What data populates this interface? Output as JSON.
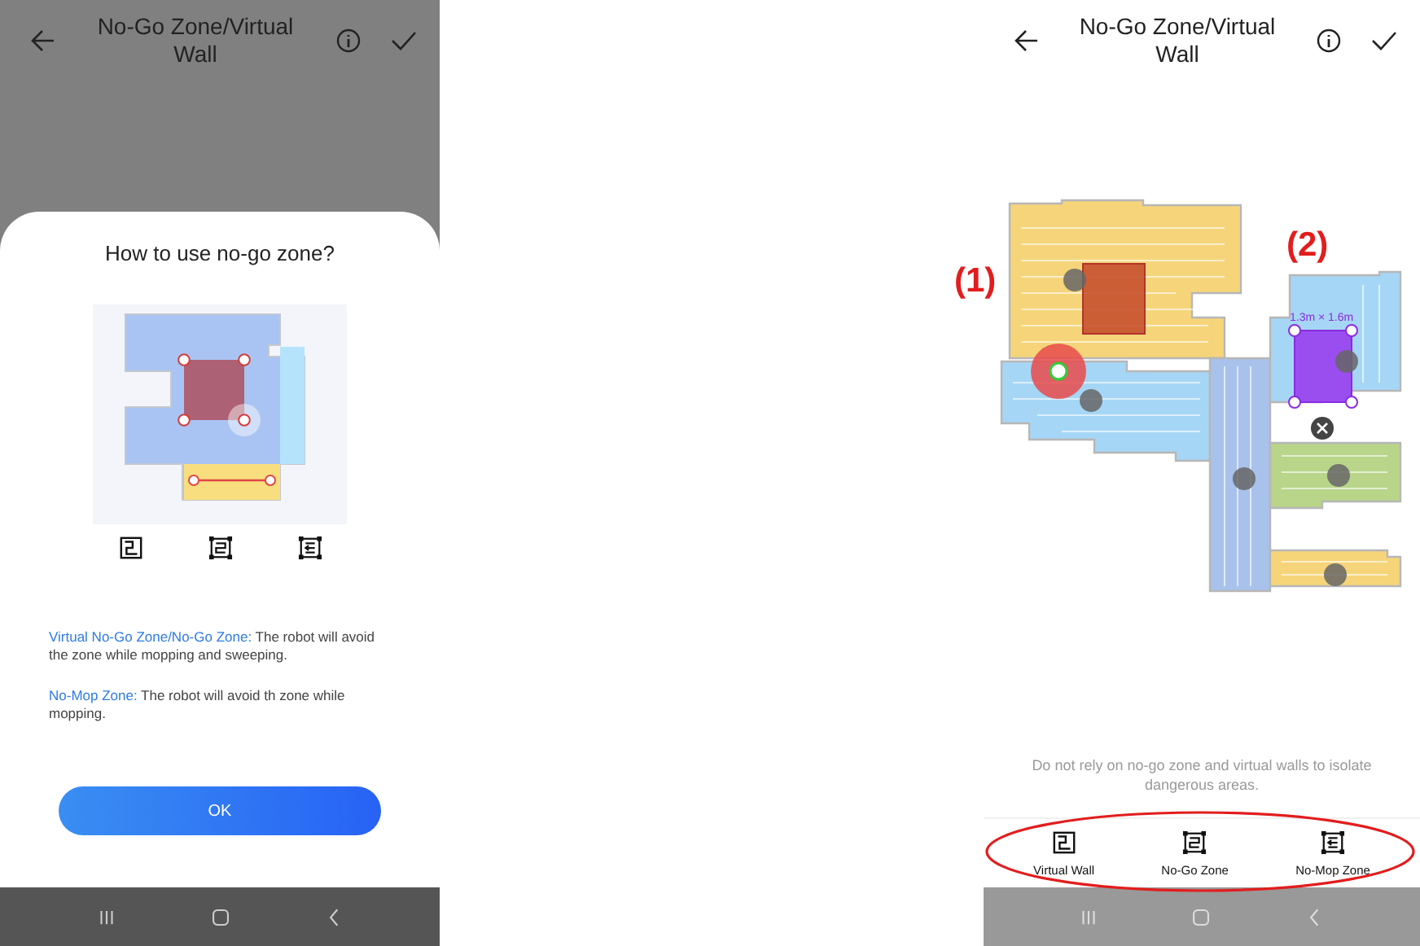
{
  "left_screen": {
    "header": {
      "title": "No-Go Zone/Virtual Wall"
    },
    "dialog": {
      "title": "How to use no-go zone?",
      "modes": [
        {
          "kind": "virtual_wall"
        },
        {
          "kind": "no_go"
        },
        {
          "kind": "no_mop"
        }
      ],
      "descriptions": [
        {
          "term": "Virtual No-Go Zone/No-Go Zone:",
          "text": "The robot will avoid the zone while mopping and sweeping."
        },
        {
          "term": "No-Mop Zone:",
          "text": "The robot will avoid th zone while mopping."
        }
      ],
      "button": "OK"
    }
  },
  "right_screen": {
    "header": {
      "title": "No-Go Zone/Virtual Wall"
    },
    "map": {
      "zone_size": "1.3m × 1.6m"
    },
    "notice": "Do not rely on no-go zone and virtual walls to isolate dangerous areas.",
    "tools": [
      {
        "kind": "virtual_wall",
        "label": "Virtual Wall"
      },
      {
        "kind": "no_go",
        "label": "No-Go Zone"
      },
      {
        "kind": "no_mop",
        "label": "No-Mop Zone"
      }
    ]
  },
  "annotations": [
    {
      "label": "(1)"
    },
    {
      "label": "(2)"
    }
  ]
}
